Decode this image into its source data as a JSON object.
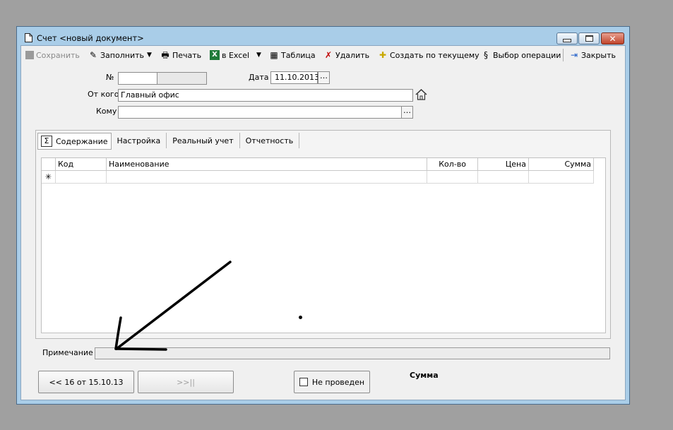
{
  "window": {
    "title": "Счет <новый документ>"
  },
  "toolbar": {
    "save": "Сохранить",
    "fill": "Заполнить",
    "print": "Печать",
    "excel": "в Excel",
    "table": "Таблица",
    "delete": "Удалить",
    "create_from_current": "Создать по текущему",
    "choose_operation": "Выбор операции",
    "close": "Закрыть"
  },
  "form": {
    "number_label": "№",
    "number_value": "",
    "date_label": "Дата",
    "date_value": "11.10.2013",
    "from_label": "От кого",
    "from_value": "Главный офис",
    "to_label": "Кому",
    "to_value": ""
  },
  "tabs": [
    "Содержание",
    "Настройка",
    "Реальный учет",
    "Отчетность"
  ],
  "grid": {
    "columns": [
      "Код",
      "Наименование",
      "Кол-во",
      "Цена",
      "Сумма"
    ],
    "new_row_marker": "✳"
  },
  "note": {
    "label": "Примечание",
    "value": ""
  },
  "footer": {
    "prev_button": "<< 16 от 15.10.13",
    "next_button": ">>||",
    "not_posted": "Не проведен",
    "not_posted_checked": false,
    "sum_label": "Сумма"
  },
  "icons": {
    "document": "document-icon",
    "save": "save-icon",
    "fill": "fill-icon",
    "print": "printer-icon",
    "excel": "excel-icon",
    "table": "table-icon",
    "delete": "delete-icon",
    "create": "plus-icon",
    "operation": "operation-icon",
    "close": "close-door-icon",
    "home": "home-icon",
    "sigma": "sigma-icon"
  }
}
